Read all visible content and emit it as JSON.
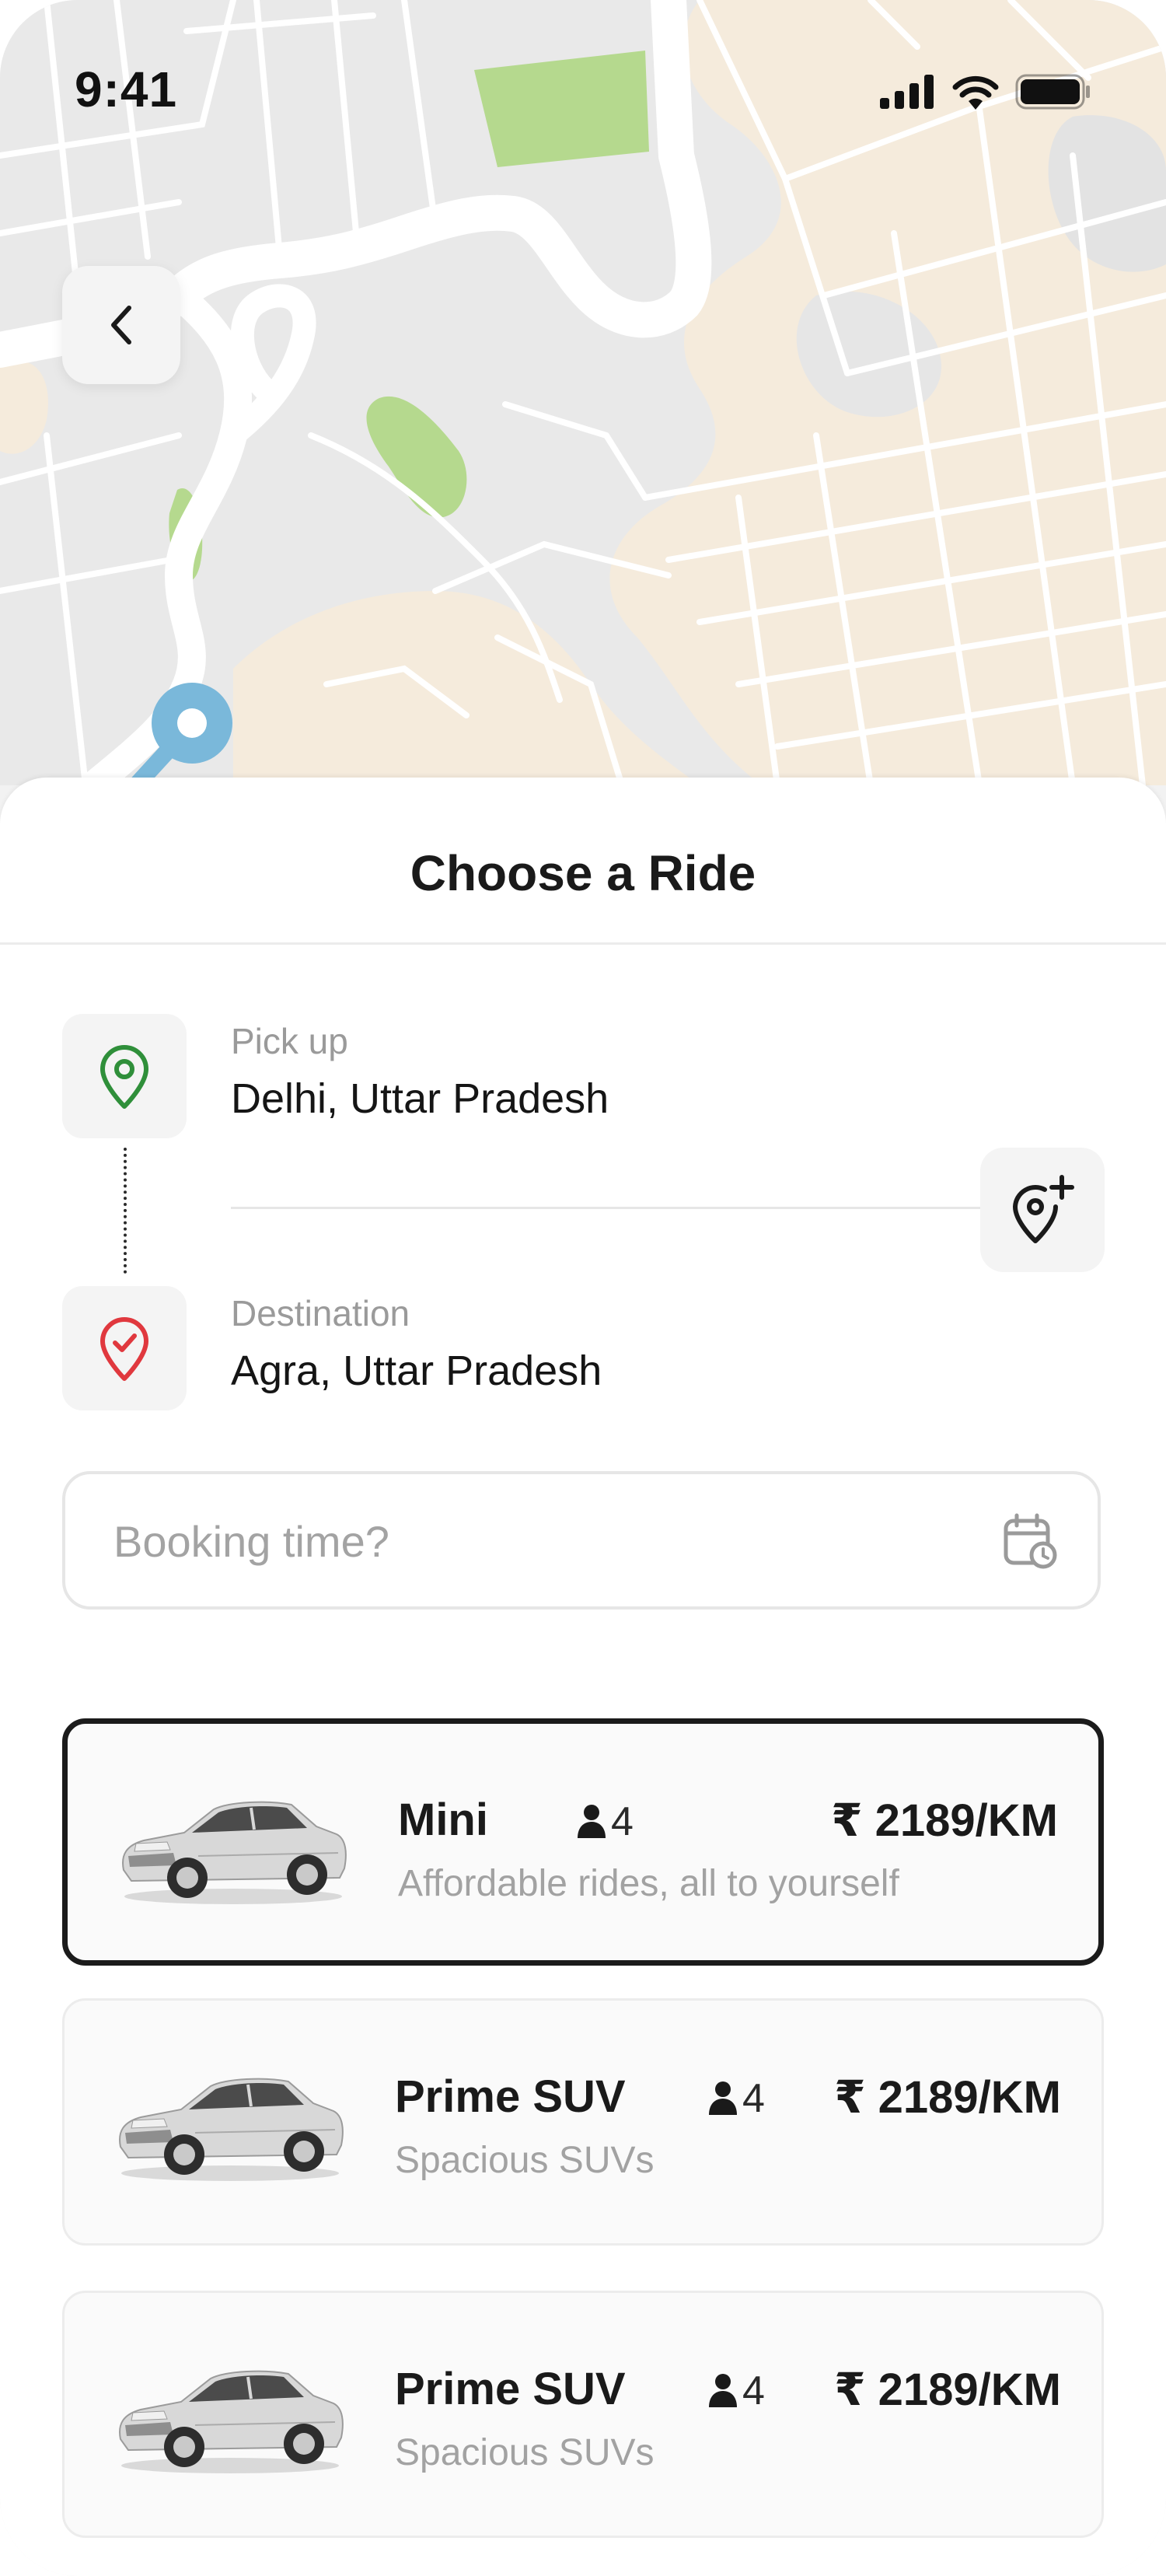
{
  "status_bar": {
    "time": "9:41"
  },
  "sheet": {
    "title": "Choose a Ride"
  },
  "pickup": {
    "label": "Pick up",
    "value": "Delhi, Uttar Pradesh"
  },
  "destination": {
    "label": "Destination",
    "value": "Agra, Uttar Pradesh"
  },
  "booking": {
    "placeholder": "Booking time?"
  },
  "rides": [
    {
      "name": "Mini",
      "seats": "4",
      "description": "Affordable rides, all to yourself",
      "price": "₹ 2189/KM",
      "selected": true
    },
    {
      "name": "Prime SUV",
      "seats": "4",
      "description": "Spacious SUVs",
      "price": "₹ 2189/KM",
      "selected": false
    },
    {
      "name": "Prime SUV",
      "seats": "4",
      "description": "Spacious SUVs",
      "price": "₹ 2189/KM",
      "selected": false
    }
  ],
  "icons": {
    "back": "chevron-left-icon",
    "pickup": "location-pin-icon",
    "destination": "location-check-icon",
    "add_stop": "location-add-icon",
    "calendar": "calendar-clock-icon",
    "seats": "person-icon"
  },
  "colors": {
    "pickup_green": "#2f8f3a",
    "destination_red": "#e0383e",
    "route_blue": "#7ab8da",
    "map_park": "#b5d98e",
    "map_sand": "#f4ead8",
    "selected_border": "#1b1b1b"
  }
}
